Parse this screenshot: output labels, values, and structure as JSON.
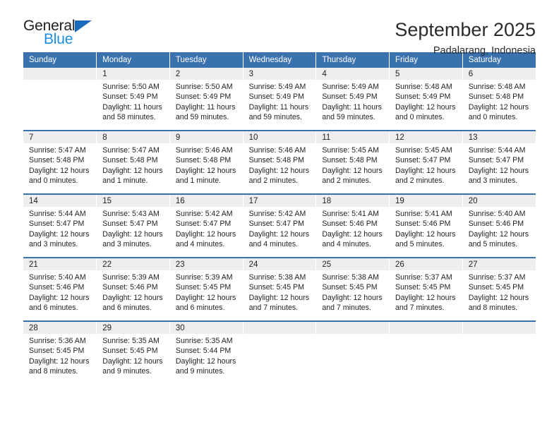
{
  "brand": {
    "name_top": "General",
    "name_bottom": "Blue",
    "triangle_color": "#1b6bbd",
    "blue_text_color": "#1b8ee0"
  },
  "header": {
    "title": "September 2025",
    "subtitle": "Padalarang, Indonesia"
  },
  "theme": {
    "header_blue": "#3a72b0",
    "daynum_band": "#eeeeee",
    "text": "#231f20"
  },
  "weekday_headers": [
    "Sunday",
    "Monday",
    "Tuesday",
    "Wednesday",
    "Thursday",
    "Friday",
    "Saturday"
  ],
  "weeks": [
    {
      "days": [
        {
          "num": "",
          "sunrise": "",
          "sunset": "",
          "daylight1": "",
          "daylight2": ""
        },
        {
          "num": "1",
          "sunrise": "Sunrise: 5:50 AM",
          "sunset": "Sunset: 5:49 PM",
          "daylight1": "Daylight: 11 hours",
          "daylight2": "and 58 minutes."
        },
        {
          "num": "2",
          "sunrise": "Sunrise: 5:50 AM",
          "sunset": "Sunset: 5:49 PM",
          "daylight1": "Daylight: 11 hours",
          "daylight2": "and 59 minutes."
        },
        {
          "num": "3",
          "sunrise": "Sunrise: 5:49 AM",
          "sunset": "Sunset: 5:49 PM",
          "daylight1": "Daylight: 11 hours",
          "daylight2": "and 59 minutes."
        },
        {
          "num": "4",
          "sunrise": "Sunrise: 5:49 AM",
          "sunset": "Sunset: 5:49 PM",
          "daylight1": "Daylight: 11 hours",
          "daylight2": "and 59 minutes."
        },
        {
          "num": "5",
          "sunrise": "Sunrise: 5:48 AM",
          "sunset": "Sunset: 5:49 PM",
          "daylight1": "Daylight: 12 hours",
          "daylight2": "and 0 minutes."
        },
        {
          "num": "6",
          "sunrise": "Sunrise: 5:48 AM",
          "sunset": "Sunset: 5:48 PM",
          "daylight1": "Daylight: 12 hours",
          "daylight2": "and 0 minutes."
        }
      ]
    },
    {
      "days": [
        {
          "num": "7",
          "sunrise": "Sunrise: 5:47 AM",
          "sunset": "Sunset: 5:48 PM",
          "daylight1": "Daylight: 12 hours",
          "daylight2": "and 0 minutes."
        },
        {
          "num": "8",
          "sunrise": "Sunrise: 5:47 AM",
          "sunset": "Sunset: 5:48 PM",
          "daylight1": "Daylight: 12 hours",
          "daylight2": "and 1 minute."
        },
        {
          "num": "9",
          "sunrise": "Sunrise: 5:46 AM",
          "sunset": "Sunset: 5:48 PM",
          "daylight1": "Daylight: 12 hours",
          "daylight2": "and 1 minute."
        },
        {
          "num": "10",
          "sunrise": "Sunrise: 5:46 AM",
          "sunset": "Sunset: 5:48 PM",
          "daylight1": "Daylight: 12 hours",
          "daylight2": "and 2 minutes."
        },
        {
          "num": "11",
          "sunrise": "Sunrise: 5:45 AM",
          "sunset": "Sunset: 5:48 PM",
          "daylight1": "Daylight: 12 hours",
          "daylight2": "and 2 minutes."
        },
        {
          "num": "12",
          "sunrise": "Sunrise: 5:45 AM",
          "sunset": "Sunset: 5:47 PM",
          "daylight1": "Daylight: 12 hours",
          "daylight2": "and 2 minutes."
        },
        {
          "num": "13",
          "sunrise": "Sunrise: 5:44 AM",
          "sunset": "Sunset: 5:47 PM",
          "daylight1": "Daylight: 12 hours",
          "daylight2": "and 3 minutes."
        }
      ]
    },
    {
      "days": [
        {
          "num": "14",
          "sunrise": "Sunrise: 5:44 AM",
          "sunset": "Sunset: 5:47 PM",
          "daylight1": "Daylight: 12 hours",
          "daylight2": "and 3 minutes."
        },
        {
          "num": "15",
          "sunrise": "Sunrise: 5:43 AM",
          "sunset": "Sunset: 5:47 PM",
          "daylight1": "Daylight: 12 hours",
          "daylight2": "and 3 minutes."
        },
        {
          "num": "16",
          "sunrise": "Sunrise: 5:42 AM",
          "sunset": "Sunset: 5:47 PM",
          "daylight1": "Daylight: 12 hours",
          "daylight2": "and 4 minutes."
        },
        {
          "num": "17",
          "sunrise": "Sunrise: 5:42 AM",
          "sunset": "Sunset: 5:47 PM",
          "daylight1": "Daylight: 12 hours",
          "daylight2": "and 4 minutes."
        },
        {
          "num": "18",
          "sunrise": "Sunrise: 5:41 AM",
          "sunset": "Sunset: 5:46 PM",
          "daylight1": "Daylight: 12 hours",
          "daylight2": "and 4 minutes."
        },
        {
          "num": "19",
          "sunrise": "Sunrise: 5:41 AM",
          "sunset": "Sunset: 5:46 PM",
          "daylight1": "Daylight: 12 hours",
          "daylight2": "and 5 minutes."
        },
        {
          "num": "20",
          "sunrise": "Sunrise: 5:40 AM",
          "sunset": "Sunset: 5:46 PM",
          "daylight1": "Daylight: 12 hours",
          "daylight2": "and 5 minutes."
        }
      ]
    },
    {
      "days": [
        {
          "num": "21",
          "sunrise": "Sunrise: 5:40 AM",
          "sunset": "Sunset: 5:46 PM",
          "daylight1": "Daylight: 12 hours",
          "daylight2": "and 6 minutes."
        },
        {
          "num": "22",
          "sunrise": "Sunrise: 5:39 AM",
          "sunset": "Sunset: 5:46 PM",
          "daylight1": "Daylight: 12 hours",
          "daylight2": "and 6 minutes."
        },
        {
          "num": "23",
          "sunrise": "Sunrise: 5:39 AM",
          "sunset": "Sunset: 5:45 PM",
          "daylight1": "Daylight: 12 hours",
          "daylight2": "and 6 minutes."
        },
        {
          "num": "24",
          "sunrise": "Sunrise: 5:38 AM",
          "sunset": "Sunset: 5:45 PM",
          "daylight1": "Daylight: 12 hours",
          "daylight2": "and 7 minutes."
        },
        {
          "num": "25",
          "sunrise": "Sunrise: 5:38 AM",
          "sunset": "Sunset: 5:45 PM",
          "daylight1": "Daylight: 12 hours",
          "daylight2": "and 7 minutes."
        },
        {
          "num": "26",
          "sunrise": "Sunrise: 5:37 AM",
          "sunset": "Sunset: 5:45 PM",
          "daylight1": "Daylight: 12 hours",
          "daylight2": "and 7 minutes."
        },
        {
          "num": "27",
          "sunrise": "Sunrise: 5:37 AM",
          "sunset": "Sunset: 5:45 PM",
          "daylight1": "Daylight: 12 hours",
          "daylight2": "and 8 minutes."
        }
      ]
    },
    {
      "days": [
        {
          "num": "28",
          "sunrise": "Sunrise: 5:36 AM",
          "sunset": "Sunset: 5:45 PM",
          "daylight1": "Daylight: 12 hours",
          "daylight2": "and 8 minutes."
        },
        {
          "num": "29",
          "sunrise": "Sunrise: 5:35 AM",
          "sunset": "Sunset: 5:45 PM",
          "daylight1": "Daylight: 12 hours",
          "daylight2": "and 9 minutes."
        },
        {
          "num": "30",
          "sunrise": "Sunrise: 5:35 AM",
          "sunset": "Sunset: 5:44 PM",
          "daylight1": "Daylight: 12 hours",
          "daylight2": "and 9 minutes."
        },
        {
          "num": "",
          "sunrise": "",
          "sunset": "",
          "daylight1": "",
          "daylight2": ""
        },
        {
          "num": "",
          "sunrise": "",
          "sunset": "",
          "daylight1": "",
          "daylight2": ""
        },
        {
          "num": "",
          "sunrise": "",
          "sunset": "",
          "daylight1": "",
          "daylight2": ""
        },
        {
          "num": "",
          "sunrise": "",
          "sunset": "",
          "daylight1": "",
          "daylight2": ""
        }
      ]
    }
  ]
}
